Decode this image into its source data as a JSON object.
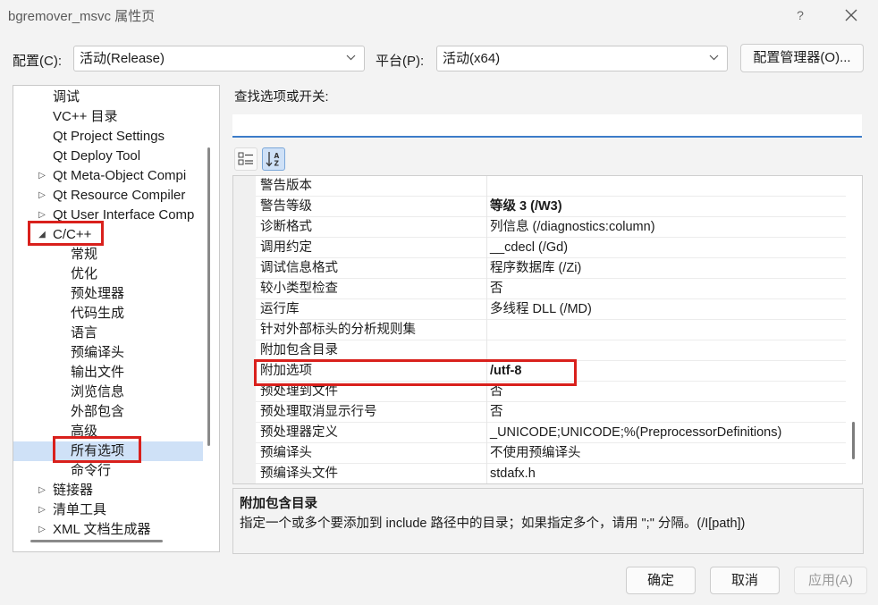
{
  "window": {
    "title": "bgremover_msvc 属性页",
    "help_label": "?"
  },
  "config": {
    "label": "配置(C):",
    "value": "活动(Release)",
    "platform_label": "平台(P):",
    "platform_value": "活动(x64)",
    "manager_button": "配置管理器(O)..."
  },
  "tree": {
    "items": [
      {
        "label": "调试",
        "level": 1,
        "arrow": ""
      },
      {
        "label": "VC++ 目录",
        "level": 1,
        "arrow": ""
      },
      {
        "label": "Qt Project Settings",
        "level": 1,
        "arrow": ""
      },
      {
        "label": "Qt Deploy Tool",
        "level": 1,
        "arrow": ""
      },
      {
        "label": "Qt Meta-Object Compi",
        "level": 1,
        "arrow": "collapsed"
      },
      {
        "label": "Qt Resource Compiler",
        "level": 1,
        "arrow": "collapsed"
      },
      {
        "label": "Qt User Interface Comp",
        "level": 1,
        "arrow": "collapsed"
      },
      {
        "label": "C/C++",
        "level": 1,
        "arrow": "expanded"
      },
      {
        "label": "常规",
        "level": 2,
        "arrow": ""
      },
      {
        "label": "优化",
        "level": 2,
        "arrow": ""
      },
      {
        "label": "预处理器",
        "level": 2,
        "arrow": ""
      },
      {
        "label": "代码生成",
        "level": 2,
        "arrow": ""
      },
      {
        "label": "语言",
        "level": 2,
        "arrow": ""
      },
      {
        "label": "预编译头",
        "level": 2,
        "arrow": ""
      },
      {
        "label": "输出文件",
        "level": 2,
        "arrow": ""
      },
      {
        "label": "浏览信息",
        "level": 2,
        "arrow": ""
      },
      {
        "label": "外部包含",
        "level": 2,
        "arrow": ""
      },
      {
        "label": "高级",
        "level": 2,
        "arrow": ""
      },
      {
        "label": "所有选项",
        "level": 2,
        "arrow": "",
        "selected": true
      },
      {
        "label": "命令行",
        "level": 2,
        "arrow": ""
      },
      {
        "label": "链接器",
        "level": 1,
        "arrow": "collapsed"
      },
      {
        "label": "清单工具",
        "level": 1,
        "arrow": "collapsed"
      },
      {
        "label": "XML 文档生成器",
        "level": 1,
        "arrow": "collapsed"
      }
    ]
  },
  "search": {
    "label": "查找选项或开关:",
    "value": ""
  },
  "grid": {
    "rows": [
      {
        "name": "警告版本",
        "value": "",
        "bold": false
      },
      {
        "name": "警告等级",
        "value": "等级 3 (/W3)",
        "bold": true
      },
      {
        "name": "诊断格式",
        "value": "列信息 (/diagnostics:column)",
        "bold": false
      },
      {
        "name": "调用约定",
        "value": "__cdecl (/Gd)",
        "bold": false
      },
      {
        "name": "调试信息格式",
        "value": "程序数据库 (/Zi)",
        "bold": false
      },
      {
        "name": "较小类型检查",
        "value": "否",
        "bold": false
      },
      {
        "name": "运行库",
        "value": "多线程 DLL (/MD)",
        "bold": false
      },
      {
        "name": "针对外部标头的分析规则集",
        "value": "",
        "bold": false
      },
      {
        "name": "附加包含目录",
        "value": "",
        "bold": false
      },
      {
        "name": "附加选项",
        "value": "/utf-8",
        "bold": true
      },
      {
        "name": "预处理到文件",
        "value": "否",
        "bold": false
      },
      {
        "name": "预处理取消显示行号",
        "value": "否",
        "bold": false
      },
      {
        "name": "预处理器定义",
        "value": "_UNICODE;UNICODE;%(PreprocessorDefinitions)",
        "bold": false
      },
      {
        "name": "预编译头",
        "value": "不使用预编译头",
        "bold": false
      },
      {
        "name": "预编译头文件",
        "value": "stdafx.h",
        "bold": false
      }
    ]
  },
  "description": {
    "title": "附加包含目录",
    "text": "指定一个或多个要添加到 include 路径中的目录；如果指定多个，请用 \";\" 分隔。(/I[path])"
  },
  "buttons": {
    "ok": "确定",
    "cancel": "取消",
    "apply": "应用(A)"
  },
  "colors": {
    "annotation_red": "#d9201c",
    "selection": "#cfe1f7",
    "accent": "#3d7cc9"
  }
}
